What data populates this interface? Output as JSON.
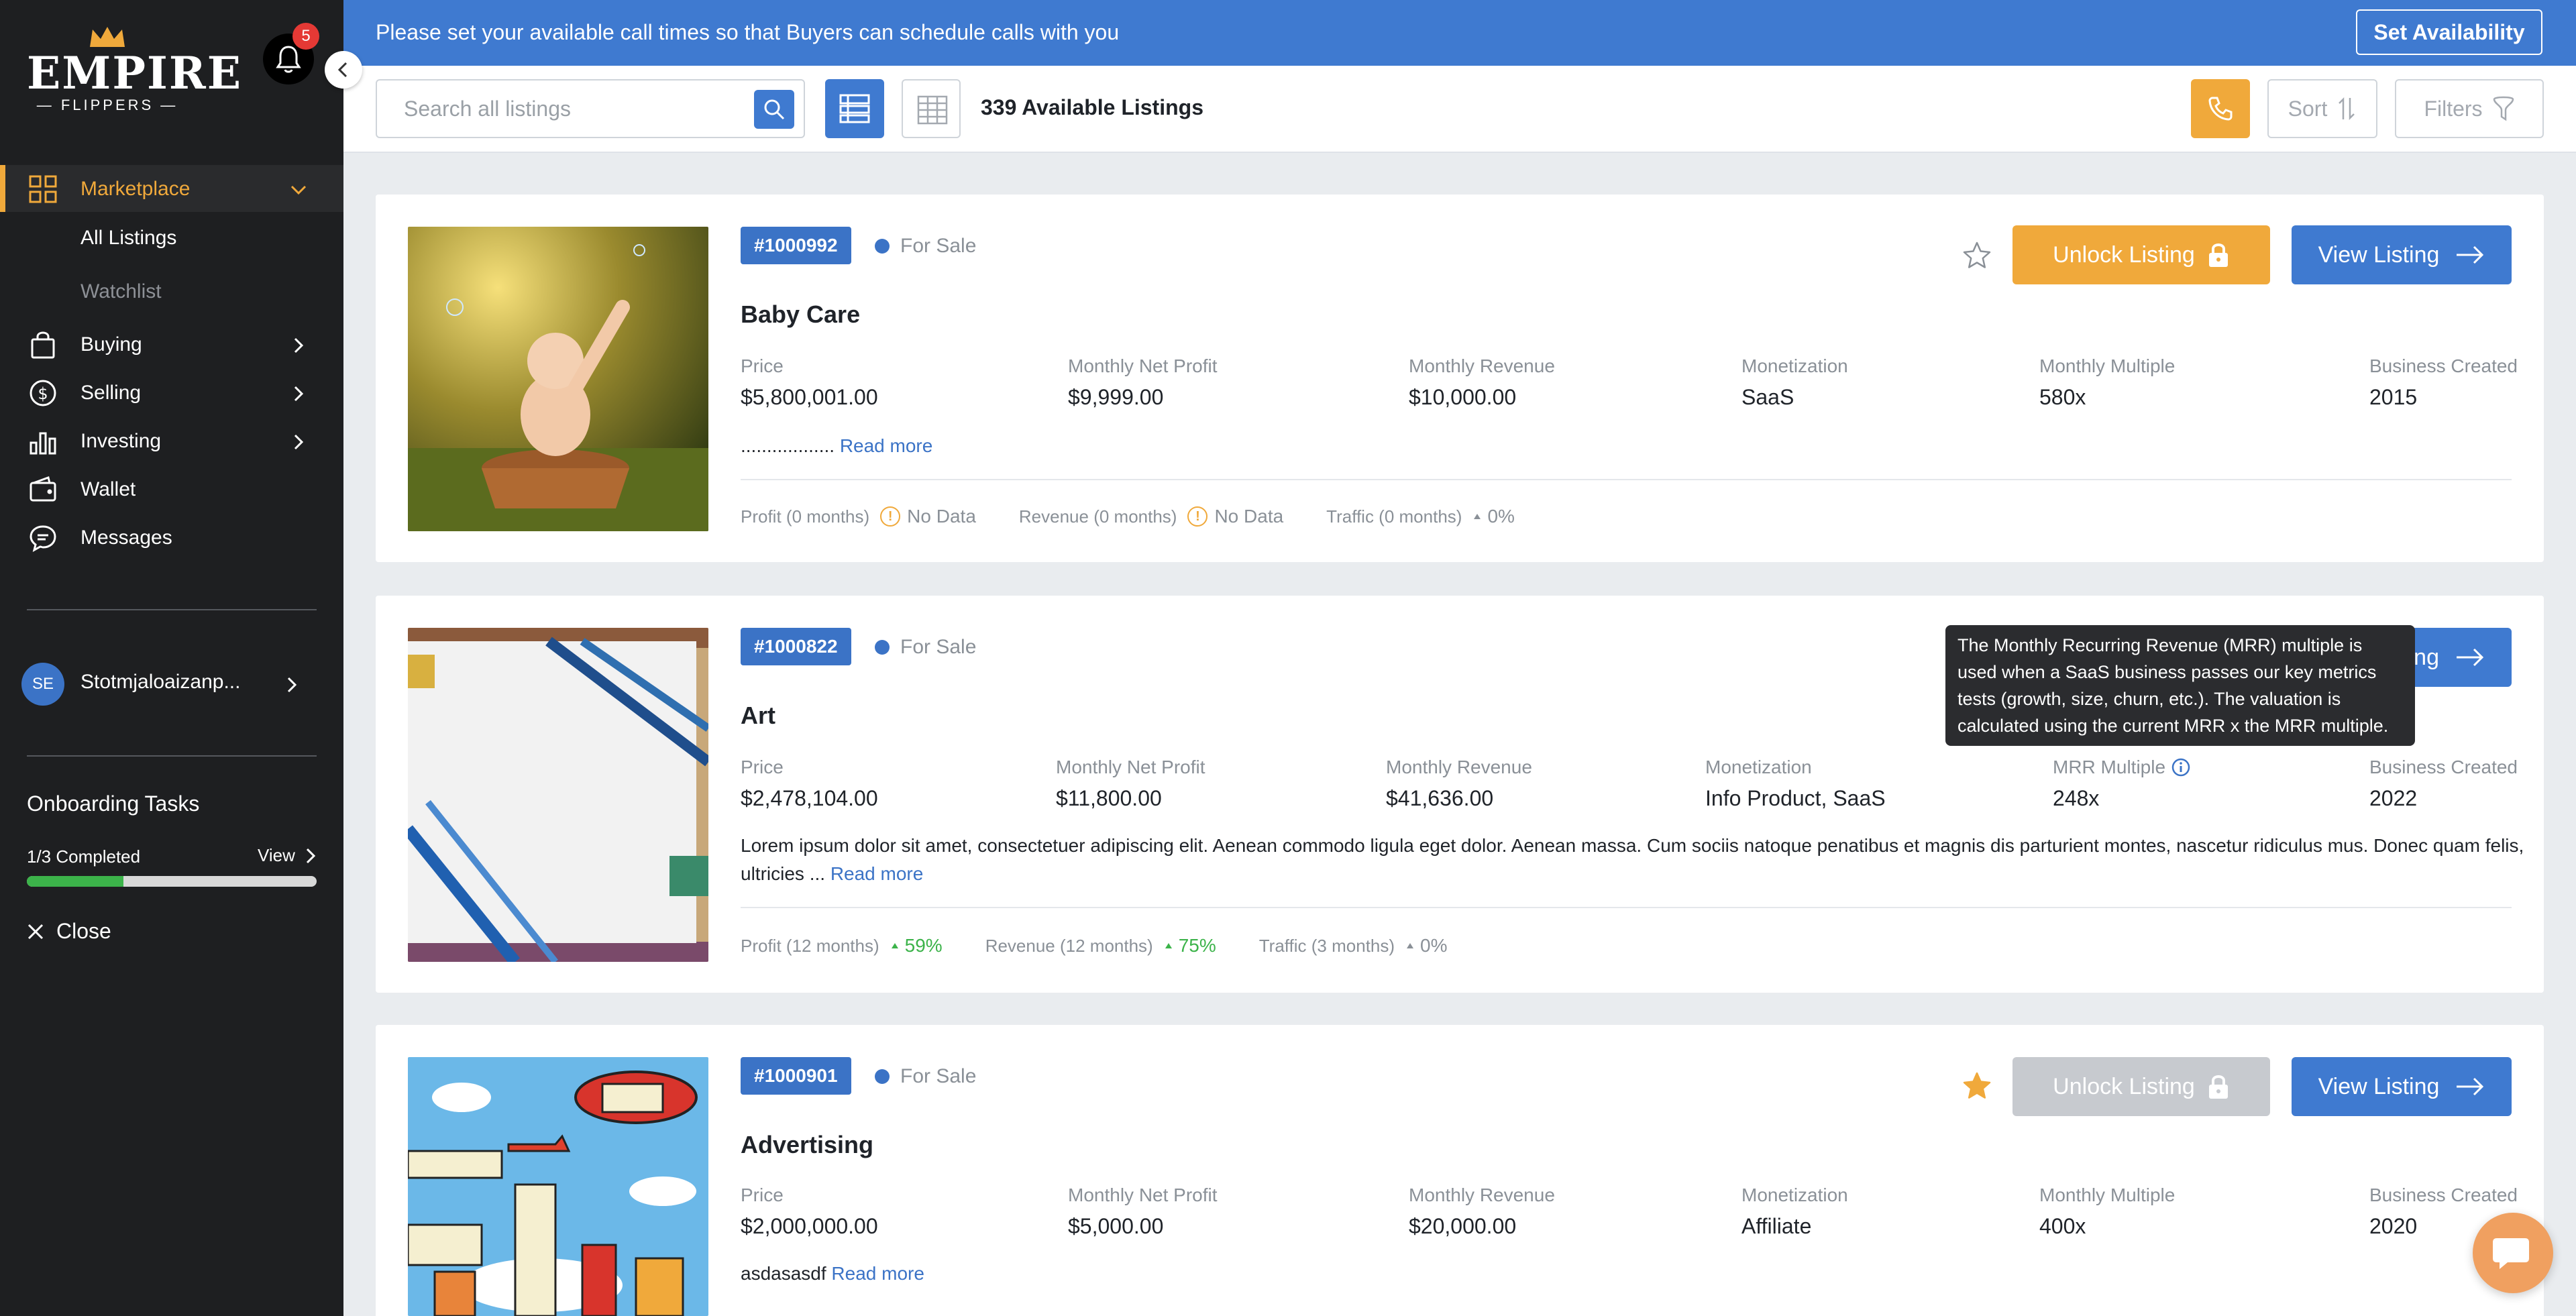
{
  "sidebar": {
    "logo_word": "EMPIRE",
    "logo_sub": "FLIPPERS",
    "notifications_count": "5",
    "nav": {
      "marketplace": "Marketplace",
      "all_listings": "All Listings",
      "watchlist": "Watchlist",
      "buying": "Buying",
      "selling": "Selling",
      "investing": "Investing",
      "wallet": "Wallet",
      "messages": "Messages"
    },
    "user_initials": "SE",
    "username": "Stotmjaloaizanp...",
    "onboarding": {
      "title": "Onboarding Tasks",
      "completed": "1/3 Completed",
      "view": "View",
      "progress": 0.333,
      "close": "Close"
    },
    "accent_color": "#f0a93b"
  },
  "banner": {
    "text": "Please set your available call times so that Buyers can schedule calls with you",
    "button": "Set Availability"
  },
  "toolbar": {
    "search_placeholder": "Search all listings",
    "available": "339 Available Listings",
    "sort": "Sort",
    "filters": "Filters"
  },
  "listings": [
    {
      "id": "#1000992",
      "status": "For Sale",
      "title": "Baby Care",
      "metrics": [
        {
          "label": "Price",
          "value": "$5,800,001.00"
        },
        {
          "label": "Monthly Net Profit",
          "value": "$9,999.00"
        },
        {
          "label": "Monthly Revenue",
          "value": "$10,000.00"
        },
        {
          "label": "Monetization",
          "value": "SaaS"
        },
        {
          "label": "Monthly Multiple",
          "value": "580x"
        },
        {
          "label": "Business Created",
          "value": "2015"
        }
      ],
      "desc": "..................",
      "read_more": "Read more",
      "stats": {
        "profit_label": "Profit (0 months)",
        "profit_value": "No Data",
        "revenue_label": "Revenue (0 months)",
        "revenue_value": "No Data",
        "traffic_label": "Traffic (0 months)",
        "traffic_value": "0%"
      },
      "starred": false,
      "unlock": "Unlock Listing",
      "view": "View Listing"
    },
    {
      "id": "#1000822",
      "status": "For Sale",
      "title": "Art",
      "metrics": [
        {
          "label": "Price",
          "value": "$2,478,104.00"
        },
        {
          "label": "Monthly Net Profit",
          "value": "$11,800.00"
        },
        {
          "label": "Monthly Revenue",
          "value": "$41,636.00"
        },
        {
          "label": "Monetization",
          "value": "Info Product, SaaS"
        },
        {
          "label": "MRR Multiple",
          "value": "248x"
        },
        {
          "label": "Business Created",
          "value": "2022"
        }
      ],
      "desc": "Lorem ipsum dolor sit amet, consectetuer adipiscing elit. Aenean commodo ligula eget dolor. Aenean massa. Cum sociis natoque penatibus et magnis dis parturient montes, nascetur ridiculus mus. Donec quam felis, ultricies ...",
      "read_more": "Read more",
      "stats": {
        "profit_label": "Profit (12 months)",
        "profit_value": "59%",
        "revenue_label": "Revenue (12 months)",
        "revenue_value": "75%",
        "traffic_label": "Traffic (3 months)",
        "traffic_value": "0%"
      },
      "view_partial": "ing",
      "tooltip": "The Monthly Recurring Revenue (MRR) multiple is used when a SaaS business passes our key metrics tests (growth, size, churn, etc.). The valuation is calculated using the current MRR x the MRR multiple."
    },
    {
      "id": "#1000901",
      "status": "For Sale",
      "title": "Advertising",
      "metrics": [
        {
          "label": "Price",
          "value": "$2,000,000.00"
        },
        {
          "label": "Monthly Net Profit",
          "value": "$5,000.00"
        },
        {
          "label": "Monthly Revenue",
          "value": "$20,000.00"
        },
        {
          "label": "Monetization",
          "value": "Affiliate"
        },
        {
          "label": "Monthly Multiple",
          "value": "400x"
        },
        {
          "label": "Business Created",
          "value": "2020"
        }
      ],
      "desc": "asdasasdf",
      "read_more": "Read more",
      "starred": true,
      "unlock": "Unlock Listing",
      "view": "View Listing"
    }
  ]
}
